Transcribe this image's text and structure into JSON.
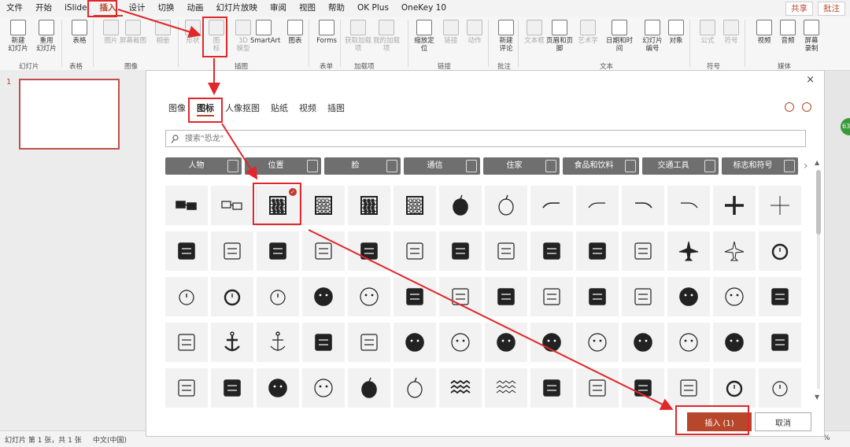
{
  "menu": {
    "items": [
      "文件",
      "开始",
      "iSlide",
      "插入",
      "设计",
      "切换",
      "动画",
      "幻灯片放映",
      "审阅",
      "视图",
      "帮助",
      "OK Plus",
      "OneKey 10"
    ],
    "active_index": 3,
    "share": "共享",
    "comments": "批注"
  },
  "ribbon": {
    "buttons": [
      {
        "label": "新建\n幻灯片"
      },
      {
        "label": "重用\n幻灯片"
      },
      {
        "label": "表格"
      },
      {
        "label": "图片"
      },
      {
        "label": "屏幕截图"
      },
      {
        "label": "相册"
      },
      {
        "label": "形状"
      },
      {
        "label": "图\n标"
      },
      {
        "label": "3D\n模型"
      },
      {
        "label": "SmartArt"
      },
      {
        "label": "图表"
      },
      {
        "label": "Forms"
      },
      {
        "label": "获取加载项"
      },
      {
        "label": "我的加载项"
      },
      {
        "label": "缩放定\n位"
      },
      {
        "label": "链接"
      },
      {
        "label": "动作"
      },
      {
        "label": "新建\n评论"
      },
      {
        "label": "文本框"
      },
      {
        "label": "页眉和页脚"
      },
      {
        "label": "艺术字"
      },
      {
        "label": "日期和时间"
      },
      {
        "label": "幻灯片\n编号"
      },
      {
        "label": "对象"
      },
      {
        "label": "公式"
      },
      {
        "label": "符号"
      },
      {
        "label": "视频"
      },
      {
        "label": "音频"
      },
      {
        "label": "屏幕\n录制"
      }
    ],
    "groups": [
      "幻灯片",
      "表格",
      "图像",
      "插图",
      "表单",
      "加载项",
      "链接",
      "批注",
      "文本",
      "符号",
      "媒体"
    ]
  },
  "slides": {
    "number": "1"
  },
  "status": {
    "slide_info": "幻灯片 第 1 张，共 1 张",
    "language": "中文(中国)",
    "zoom": "%"
  },
  "dialog": {
    "close": "×",
    "tabs": [
      "图像",
      "图标",
      "人像抠图",
      "贴纸",
      "视频",
      "插图"
    ],
    "active_tab": 1,
    "search_placeholder": "搜索\"恐龙\"",
    "categories": [
      "人物",
      "位置",
      "脸",
      "通信",
      "住家",
      "食品和饮料",
      "交通工具",
      "标志和符号"
    ],
    "insert_label": "插入 (1)",
    "cancel_label": "取消",
    "selected_icon": "abacus",
    "icons": [
      "3d-glasses",
      "3d-glasses-outline",
      "abacus",
      "abacus-outline",
      "abacus-2",
      "abacus-2-outline",
      "acorn",
      "acorn-outline",
      "turn-right",
      "turn-right-outline",
      "turn-left",
      "turn-left-outline",
      "plus",
      "plus-outline",
      "address-book",
      "address-book-outline",
      "address-book-2",
      "address-book-2-outline",
      "bandage",
      "bandage-outline",
      "billboard",
      "billboard-outline",
      "africa",
      "farm",
      "farm-outline",
      "airplane",
      "airplane-outline",
      "alarm-clock",
      "alarm-clock-outline",
      "alarm-ringing",
      "alarm-ringing-outline",
      "alien",
      "alien-outline",
      "knitting",
      "knitting-outline",
      "yarn",
      "yarn-outline",
      "tape-measure",
      "tape-measure-outline",
      "button",
      "button-outline",
      "ambulance",
      "ambulance-outline",
      "anchor",
      "anchor-outline",
      "anemone",
      "anemone-outline",
      "angel-face",
      "angel-face-outline",
      "angel-face-2",
      "angry",
      "angry-outline",
      "angry-face",
      "angry-face-outline",
      "angry-face-2",
      "ant",
      "ant-outline",
      "antarctica",
      "aperture",
      "aperture-outline",
      "apple",
      "apple-outline",
      "waves",
      "waves-outline",
      "chart-board",
      "chart-board-outline",
      "aries",
      "aries-outline",
      "refresh",
      "refresh-outline"
    ]
  },
  "colors": {
    "accent": "#b7472a",
    "highlight": "#e0272b",
    "category_bg": "#6f6f6f"
  }
}
